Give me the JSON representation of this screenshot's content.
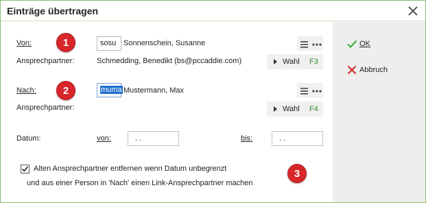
{
  "window": {
    "title": "Einträge übertragen"
  },
  "von": {
    "label": "Von:",
    "code": "sosu",
    "name": "Sonnenschein, Susanne",
    "contact_label": "Ansprechpartner:",
    "contact_value": "Schmedding, Benedikt (bs@pccaddie.com)",
    "wahl_label": "Wahl",
    "wahl_key": "F3"
  },
  "nach": {
    "label": "Nach:",
    "code": "muma",
    "name": "Mustermann, Max",
    "contact_label": "Ansprechpartner:",
    "contact_value": "",
    "wahl_label": "Wahl",
    "wahl_key": "F4"
  },
  "datum": {
    "label": "Datum:",
    "von_label": "von:",
    "von_value": ". .",
    "bis_label": "bis:",
    "bis_value": ". ."
  },
  "option": {
    "checked": true,
    "line1": "Alten Ansprechpartner entfernen wenn Datum unbegrenzt",
    "line2": "und aus einer Person in 'Nach' einen Link-Ansprechpartner machen"
  },
  "badges": [
    "1",
    "2",
    "3"
  ],
  "actions": {
    "ok_label": "OK",
    "cancel_label": "Abbruch"
  },
  "colors": {
    "accent_green": "#8cbf6a",
    "badge_red": "#d8262b",
    "key_green": "#2e8b2e",
    "selection_blue": "#1f6fd0"
  }
}
